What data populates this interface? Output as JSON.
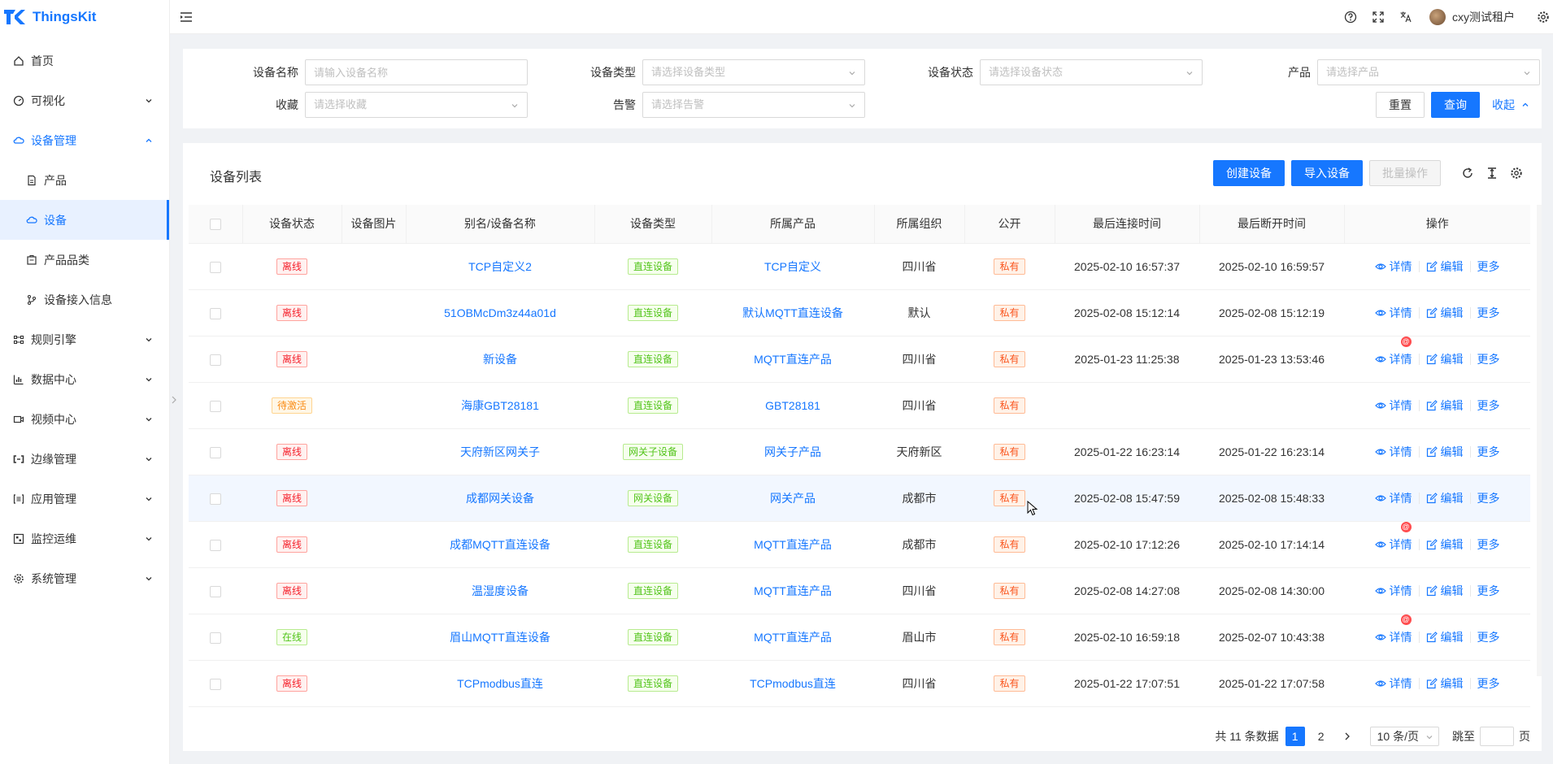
{
  "app": {
    "name": "ThingsKit"
  },
  "colors": {
    "primary": "#1677ff",
    "offline": "#f5222d",
    "pending": "#fa8c16",
    "online": "#52c41a"
  },
  "header": {
    "icons": [
      "question-circle-icon",
      "fullscreen-icon",
      "translate-icon",
      "settings-icon"
    ],
    "username": "cxy测试租户"
  },
  "sidebar": {
    "items": [
      {
        "label": "首页",
        "icon": "home-icon"
      },
      {
        "label": "可视化",
        "icon": "dashboard-icon"
      },
      {
        "label": "设备管理",
        "icon": "cloud-icon"
      },
      {
        "label": "产品",
        "icon": "file-icon"
      },
      {
        "label": "设备",
        "icon": "cloud-icon"
      },
      {
        "label": "产品品类",
        "icon": "category-icon"
      },
      {
        "label": "设备接入信息",
        "icon": "branch-icon"
      },
      {
        "label": "规则引擎",
        "icon": "rule-icon"
      },
      {
        "label": "数据中心",
        "icon": "bar-chart-icon"
      },
      {
        "label": "视频中心",
        "icon": "video-icon"
      },
      {
        "label": "边缘管理",
        "icon": "edge-icon"
      },
      {
        "label": "应用管理",
        "icon": "app-icon"
      },
      {
        "label": "监控运维",
        "icon": "monitor-icon"
      },
      {
        "label": "系统管理",
        "icon": "gear-icon"
      }
    ]
  },
  "filter": {
    "device_name_label": "设备名称",
    "device_name_placeholder": "请输入设备名称",
    "device_type_label": "设备类型",
    "device_type_placeholder": "请选择设备类型",
    "device_status_label": "设备状态",
    "device_status_placeholder": "请选择设备状态",
    "product_label": "产品",
    "product_placeholder": "请选择产品",
    "favorite_label": "收藏",
    "favorite_placeholder": "请选择收藏",
    "alarm_label": "告警",
    "alarm_placeholder": "请选择告警",
    "reset": "重置",
    "query": "查询",
    "collapse": "收起"
  },
  "list": {
    "title": "设备列表",
    "create": "创建设备",
    "import": "导入设备",
    "batch": "批量操作",
    "columns": [
      "设备状态",
      "设备图片",
      "别名/设备名称",
      "设备类型",
      "所属产品",
      "所属组织",
      "公开",
      "最后连接时间",
      "最后断开时间",
      "操作"
    ],
    "actions": {
      "detail": "详情",
      "edit": "编辑",
      "more": "更多"
    },
    "rows": [
      {
        "status": "离线",
        "status_kind": "red",
        "name": "TCP自定义2",
        "type": "直连设备",
        "product": "TCP自定义",
        "org": "四川省",
        "public": "私有",
        "last_connect": "2025-02-10 16:57:37",
        "last_disconnect": "2025-02-10 16:59:57",
        "alarm": false
      },
      {
        "status": "离线",
        "status_kind": "red",
        "name": "51OBMcDm3z44a01d",
        "type": "直连设备",
        "product": "默认MQTT直连设备",
        "org": "默认",
        "public": "私有",
        "last_connect": "2025-02-08 15:12:14",
        "last_disconnect": "2025-02-08 15:12:19",
        "alarm": false
      },
      {
        "status": "离线",
        "status_kind": "red",
        "name": "新设备",
        "type": "直连设备",
        "product": "MQTT直连产品",
        "org": "四川省",
        "public": "私有",
        "last_connect": "2025-01-23 11:25:38",
        "last_disconnect": "2025-01-23 13:53:46",
        "alarm": true
      },
      {
        "status": "待激活",
        "status_kind": "orange",
        "name": "海康GBT28181",
        "type": "直连设备",
        "product": "GBT28181",
        "org": "四川省",
        "public": "私有",
        "last_connect": "",
        "last_disconnect": "",
        "alarm": false
      },
      {
        "status": "离线",
        "status_kind": "red",
        "name": "天府新区网关子",
        "type": "网关子设备",
        "product": "网关子产品",
        "org": "天府新区",
        "public": "私有",
        "last_connect": "2025-01-22 16:23:14",
        "last_disconnect": "2025-01-22 16:23:14",
        "alarm": false
      },
      {
        "status": "离线",
        "status_kind": "red",
        "name": "成都网关设备",
        "type": "网关设备",
        "product": "网关产品",
        "org": "成都市",
        "public": "私有",
        "last_connect": "2025-02-08 15:47:59",
        "last_disconnect": "2025-02-08 15:48:33",
        "alarm": false
      },
      {
        "status": "离线",
        "status_kind": "red",
        "name": "成都MQTT直连设备",
        "type": "直连设备",
        "product": "MQTT直连产品",
        "org": "成都市",
        "public": "私有",
        "last_connect": "2025-02-10 17:12:26",
        "last_disconnect": "2025-02-10 17:14:14",
        "alarm": true
      },
      {
        "status": "离线",
        "status_kind": "red",
        "name": "温湿度设备",
        "type": "直连设备",
        "product": "MQTT直连产品",
        "org": "四川省",
        "public": "私有",
        "last_connect": "2025-02-08 14:27:08",
        "last_disconnect": "2025-02-08 14:30:00",
        "alarm": false
      },
      {
        "status": "在线",
        "status_kind": "green",
        "name": "眉山MQTT直连设备",
        "type": "直连设备",
        "product": "MQTT直连产品",
        "org": "眉山市",
        "public": "私有",
        "last_connect": "2025-02-10 16:59:18",
        "last_disconnect": "2025-02-07 10:43:38",
        "alarm": true
      },
      {
        "status": "离线",
        "status_kind": "red",
        "name": "TCPmodbus直连",
        "type": "直连设备",
        "product": "TCPmodbus直连",
        "org": "四川省",
        "public": "私有",
        "last_connect": "2025-01-22 17:07:51",
        "last_disconnect": "2025-01-22 17:07:58",
        "alarm": false
      }
    ]
  },
  "pagination": {
    "total_text": "共 11 条数据",
    "pages": [
      "1",
      "2"
    ],
    "current": "1",
    "page_size": "10 条/页",
    "jump_label": "跳至",
    "page_unit": "页"
  }
}
